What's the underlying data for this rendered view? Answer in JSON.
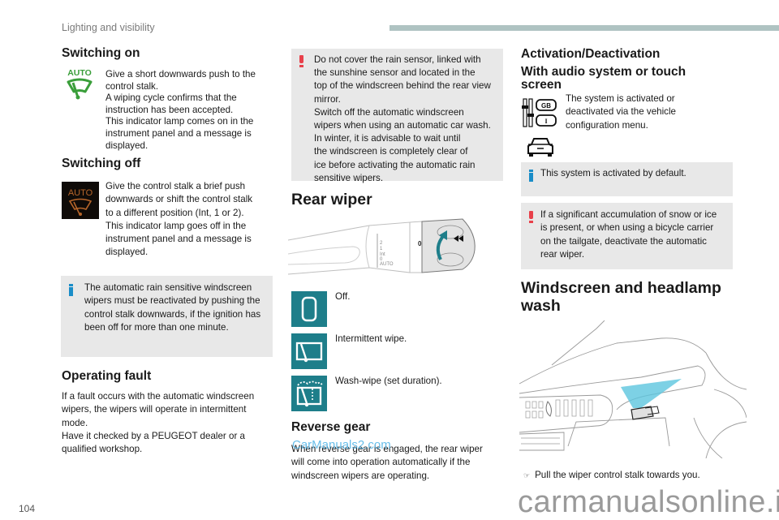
{
  "header": {
    "section_title": "Lighting and visibility"
  },
  "page_number": "104",
  "col1": {
    "switching_on": {
      "title": "Switching on",
      "icon_label": "AUTO",
      "lines": [
        "Give a short downwards push to the",
        "control stalk.",
        "A wiping cycle confirms that the",
        "instruction has been accepted.",
        "This indicator lamp comes on in the",
        "instrument panel and a message is",
        "displayed."
      ]
    },
    "switching_off": {
      "title": "Switching off",
      "icon_label": "AUTO",
      "lines": [
        "Give the control stalk a brief push",
        "downwards or shift the control stalk",
        "to a different position (Int, 1 or 2).",
        "This indicator lamp goes off in the",
        "instrument panel and a message is",
        "displayed."
      ]
    },
    "info_note": {
      "lines": [
        "The automatic rain sensitive windscreen",
        "wipers must be reactivated by pushing the",
        "control stalk downwards, if the ignition has",
        "been off for more than one minute."
      ]
    },
    "operating_fault": {
      "title": "Operating fault",
      "lines": [
        "If a fault occurs with the automatic windscreen",
        "wipers, the wipers will operate in intermittent",
        "mode.",
        "Have it checked by a PEUGEOT dealer or a",
        "qualified workshop."
      ]
    }
  },
  "col2": {
    "warning_note": {
      "lines": [
        "Do not cover the rain sensor, linked with",
        "the sunshine sensor and located in the",
        "top of the windscreen behind the rear view",
        "mirror.",
        "Switch off the automatic windscreen",
        "wipers when using an automatic car wash.",
        "In winter, it is advisable to wait until",
        "the windscreen is completely clear of",
        "ice before activating the automatic rain",
        "sensitive wipers."
      ]
    },
    "rear_wiper": {
      "title": "Rear wiper",
      "stalk_labels": [
        "2",
        "1",
        "Int",
        "0",
        "AUTO"
      ],
      "ring_labels": [
        "0"
      ],
      "modes": [
        {
          "icon": "off-icon",
          "label": "Off."
        },
        {
          "icon": "intermittent-wipe-icon",
          "label": "Intermittent wipe."
        },
        {
          "icon": "wash-wipe-icon",
          "label": "Wash-wipe (set duration)."
        }
      ]
    },
    "reverse_gear": {
      "title": "Reverse gear",
      "lines": [
        "When reverse gear is engaged, the rear wiper",
        "will come into operation automatically if the",
        "windscreen wipers are operating."
      ]
    },
    "watermark": "CarManuals2.com"
  },
  "col3": {
    "activation_title": "Activation/Deactivation",
    "audio_title_lines": [
      "With audio system or touch",
      "screen"
    ],
    "audio_icon_labels": [
      "GB",
      "I"
    ],
    "audio_lines": [
      "The system is activated or",
      "deactivated via the vehicle",
      "configuration menu."
    ],
    "info_note": {
      "lines": [
        "This system is activated by default."
      ]
    },
    "warning_note": {
      "lines": [
        "If a significant accumulation of snow or ice",
        "is present, or when using a bicycle carrier",
        "on the tailgate, deactivate the automatic",
        "rear wiper."
      ]
    },
    "wash_title_lines": [
      "Windscreen and headlamp",
      "wash"
    ],
    "wash_instruction": "Pull the wiper control stalk towards you.",
    "bullet_glyph": "☞"
  },
  "footer_watermark": "carmanualsonline.info",
  "colors": {
    "auto_on_green": "#3a9e3a",
    "auto_off_amber": "#b5652a",
    "teal_icon": "#1e7e8a",
    "warning_red": "#e8404a",
    "info_blue": "#1a8dc8",
    "note_bg": "#e8e8e8",
    "header_bar": "#afc3c2",
    "spray_cyan": "#5cc6df"
  }
}
